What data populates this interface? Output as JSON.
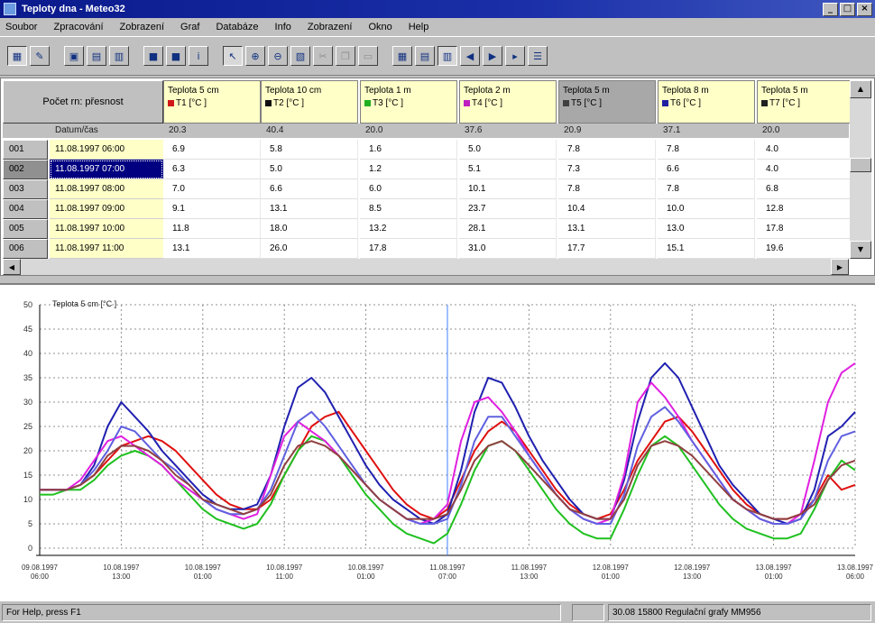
{
  "window": {
    "title": "Teploty dna - Meteo32"
  },
  "menu": [
    "Soubor",
    "Zpracování",
    "Zobrazení",
    "Graf",
    "Databáze",
    "Info",
    "Zobrazení",
    "Okno",
    "Help"
  ],
  "table": {
    "corner_label": "Počet rn: přesnost",
    "date_header": "Datum/čas",
    "columns": [
      {
        "label": "Teplota 5 cm",
        "unit": "T1 [°C ]",
        "color": "#d01818",
        "summary": "20.3"
      },
      {
        "label": "Teplota 10 cm",
        "unit": "T2 [°C ]",
        "color": "#101010",
        "summary": "40.4"
      },
      {
        "label": "Teplota 1 m",
        "unit": "T3 [°C ]",
        "color": "#20b020",
        "summary": "20.0"
      },
      {
        "label": "Teplota 2 m",
        "unit": "T4 [°C ]",
        "color": "#c020c0",
        "summary": "37.6"
      },
      {
        "label": "Teplota 5 m",
        "unit": "T5 [°C ]",
        "color": "#404040",
        "summary": "20.9"
      },
      {
        "label": "Teplota 8 m",
        "unit": "T6 [°C ]",
        "color": "#2020a0",
        "summary": "37.1"
      },
      {
        "label": "Teplota 5 m",
        "unit": "T7 [°C ]",
        "color": "#202020",
        "summary": "20.0"
      }
    ],
    "rows": [
      {
        "id": "001",
        "date": "11.08.1997 06:00",
        "values": [
          "6.9",
          "5.8",
          "1.6",
          "5.0",
          "7.8",
          "7.8",
          "4.0"
        ]
      },
      {
        "id": "002",
        "date": "11.08.1997 07:00",
        "values": [
          "6.3",
          "5.0",
          "1.2",
          "5.1",
          "7.3",
          "6.6",
          "4.0"
        ]
      },
      {
        "id": "003",
        "date": "11.08.1997 08:00",
        "values": [
          "7.0",
          "6.6",
          "6.0",
          "10.1",
          "7.8",
          "7.8",
          "6.8"
        ]
      },
      {
        "id": "004",
        "date": "11.08.1997 09:00",
        "values": [
          "9.1",
          "13.1",
          "8.5",
          "23.7",
          "10.4",
          "10.0",
          "12.8"
        ]
      },
      {
        "id": "005",
        "date": "11.08.1997 10:00",
        "values": [
          "11.8",
          "18.0",
          "13.2",
          "28.1",
          "13.1",
          "13.0",
          "17.8"
        ]
      },
      {
        "id": "006",
        "date": "11.08.1997 11:00",
        "values": [
          "13.1",
          "26.0",
          "17.8",
          "31.0",
          "17.7",
          "15.1",
          "19.6"
        ]
      }
    ],
    "selected_row": 1
  },
  "chart_data": {
    "type": "line",
    "title": "Teplota 5 cm [°C ]",
    "ylim": [
      0,
      50
    ],
    "yticks": [
      "0",
      "5",
      "10",
      "15",
      "20",
      "25",
      "30",
      "35",
      "40",
      "45",
      "50"
    ],
    "x_ticks": [
      [
        "09.08.1997",
        "06:00"
      ],
      [
        "10.08.1997",
        "13:00"
      ],
      [
        "10.08.1997",
        "01:00"
      ],
      [
        "10.08.1997",
        "11:00"
      ],
      [
        "10.08.1997",
        "01:00"
      ],
      [
        "11.08.1997",
        "07:00"
      ],
      [
        "11.08.1997",
        "13:00"
      ],
      [
        "12.08.1997",
        "01:00"
      ],
      [
        "12.08.1997",
        "13:00"
      ],
      [
        "13.08.1997",
        "01:00"
      ],
      [
        "13.08.1997",
        "06:00"
      ]
    ],
    "x": [
      0,
      2,
      4,
      6,
      8,
      10,
      12,
      14,
      16,
      18,
      20,
      22,
      24,
      26,
      28,
      30,
      32,
      34,
      36,
      38,
      40,
      42,
      44,
      46,
      48,
      50,
      52,
      54,
      56,
      58,
      60,
      62,
      64,
      66,
      68,
      70,
      72,
      74,
      76,
      78,
      80,
      82,
      84,
      86,
      88,
      90,
      92,
      94,
      96,
      98,
      100,
      102,
      104,
      106,
      108,
      110,
      112,
      114,
      116,
      118,
      120
    ],
    "series": [
      {
        "name": "T1",
        "color": "#e01010",
        "values": [
          12,
          12,
          12,
          13,
          15,
          18,
          21,
          22,
          23,
          22,
          20,
          17,
          14,
          11,
          9,
          8,
          8,
          10,
          15,
          20,
          25,
          27,
          28,
          24,
          20,
          16,
          12,
          9,
          7,
          6,
          8,
          14,
          20,
          24,
          26,
          24,
          20,
          16,
          12,
          9,
          7,
          6,
          7,
          12,
          18,
          22,
          26,
          27,
          24,
          20,
          16,
          12,
          9,
          7,
          6,
          6,
          7,
          10,
          15,
          12,
          13
        ]
      },
      {
        "name": "T2",
        "color": "#2020b0",
        "values": [
          12,
          12,
          12,
          13,
          17,
          25,
          30,
          27,
          24,
          20,
          17,
          14,
          11,
          9,
          8,
          8,
          9,
          15,
          25,
          33,
          35,
          32,
          27,
          22,
          17,
          13,
          10,
          8,
          6,
          5,
          7,
          16,
          28,
          35,
          34,
          29,
          23,
          18,
          14,
          10,
          7,
          6,
          6,
          14,
          26,
          35,
          38,
          35,
          29,
          23,
          17,
          13,
          10,
          7,
          6,
          5,
          6,
          12,
          23,
          25,
          28
        ]
      },
      {
        "name": "T3",
        "color": "#20c020",
        "values": [
          11,
          11,
          12,
          12,
          14,
          17,
          19,
          20,
          19,
          17,
          14,
          11,
          8,
          6,
          5,
          4,
          5,
          9,
          15,
          20,
          23,
          22,
          19,
          15,
          11,
          8,
          5,
          3,
          2,
          1,
          3,
          9,
          16,
          21,
          22,
          20,
          16,
          12,
          8,
          5,
          3,
          2,
          2,
          8,
          15,
          21,
          23,
          21,
          17,
          13,
          9,
          6,
          4,
          3,
          2,
          2,
          3,
          8,
          14,
          18,
          16
        ]
      },
      {
        "name": "T4",
        "color": "#e020e0",
        "values": [
          12,
          12,
          12,
          14,
          18,
          22,
          23,
          21,
          19,
          17,
          14,
          12,
          10,
          8,
          7,
          6,
          7,
          15,
          23,
          26,
          24,
          22,
          19,
          16,
          13,
          10,
          8,
          6,
          5,
          6,
          9,
          22,
          30,
          31,
          28,
          24,
          19,
          15,
          11,
          8,
          6,
          5,
          6,
          15,
          30,
          34,
          31,
          27,
          22,
          18,
          14,
          10,
          8,
          6,
          5,
          5,
          7,
          18,
          30,
          36,
          38
        ]
      },
      {
        "name": "T5",
        "color": "#6060e0",
        "values": [
          12,
          12,
          12,
          13,
          16,
          20,
          25,
          24,
          21,
          18,
          16,
          13,
          10,
          8,
          7,
          7,
          8,
          12,
          19,
          26,
          28,
          25,
          21,
          17,
          13,
          10,
          8,
          6,
          5,
          5,
          6,
          13,
          22,
          27,
          27,
          23,
          19,
          15,
          11,
          8,
          6,
          5,
          5,
          11,
          21,
          27,
          29,
          26,
          22,
          18,
          14,
          10,
          8,
          6,
          5,
          5,
          6,
          10,
          18,
          23,
          24
        ]
      },
      {
        "name": "T6",
        "color": "#904040",
        "values": [
          12,
          12,
          12,
          13,
          15,
          19,
          21,
          21,
          20,
          18,
          15,
          13,
          10,
          9,
          8,
          7,
          8,
          11,
          17,
          21,
          22,
          21,
          19,
          16,
          13,
          10,
          8,
          6,
          6,
          6,
          7,
          12,
          18,
          21,
          22,
          20,
          17,
          14,
          11,
          8,
          7,
          6,
          6,
          10,
          17,
          21,
          22,
          21,
          19,
          16,
          13,
          10,
          8,
          7,
          6,
          6,
          7,
          9,
          14,
          17,
          18
        ]
      }
    ]
  },
  "status": {
    "left": "For Help, press F1",
    "right": "30.08   15800  Regulační grafy MM956"
  }
}
